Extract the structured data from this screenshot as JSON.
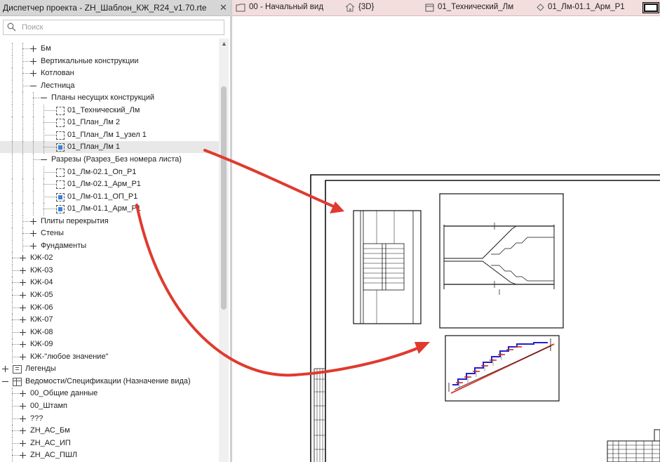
{
  "panel": {
    "title": "Диспетчер проекта - ZH_Шаблон_КЖ_R24_v1.70.rte",
    "close_label": "✕",
    "search_placeholder": "Поиск"
  },
  "tree": [
    {
      "label": "Бм",
      "depth": 2,
      "expander": "plus",
      "icon": "none"
    },
    {
      "label": "Вертикальные конструкции",
      "depth": 2,
      "expander": "plus",
      "icon": "none"
    },
    {
      "label": "Котлован",
      "depth": 2,
      "expander": "plus",
      "icon": "none"
    },
    {
      "label": "Лестница",
      "depth": 2,
      "expander": "minus",
      "icon": "none"
    },
    {
      "label": "Планы несущих конструкций",
      "depth": 3,
      "expander": "minus",
      "icon": "none"
    },
    {
      "label": "01_Технический_Лм",
      "depth": 4,
      "expander": "none",
      "icon": "view"
    },
    {
      "label": "01_План_Лм 2",
      "depth": 4,
      "expander": "none",
      "icon": "view"
    },
    {
      "label": "01_План_Лм 1_узел 1",
      "depth": 4,
      "expander": "none",
      "icon": "view"
    },
    {
      "label": "01_План_Лм 1",
      "depth": 4,
      "expander": "none",
      "icon": "view-blue",
      "selected": true
    },
    {
      "label": "Разрезы (Разрез_Без номера листа)",
      "depth": 3,
      "expander": "minus",
      "icon": "none"
    },
    {
      "label": "01_Лм-02.1_Оп_Р1",
      "depth": 4,
      "expander": "none",
      "icon": "view"
    },
    {
      "label": "01_Лм-02.1_Арм_Р1",
      "depth": 4,
      "expander": "none",
      "icon": "view"
    },
    {
      "label": "01_Лм-01.1_ОП_Р1",
      "depth": 4,
      "expander": "none",
      "icon": "view-blue"
    },
    {
      "label": "01_Лм-01.1_Арм_Р1",
      "depth": 4,
      "expander": "none",
      "icon": "view-blue"
    },
    {
      "label": "Плиты перекрытия",
      "depth": 2,
      "expander": "plus",
      "icon": "none"
    },
    {
      "label": "Стены",
      "depth": 2,
      "expander": "plus",
      "icon": "none"
    },
    {
      "label": "Фундаменты",
      "depth": 2,
      "expander": "plus",
      "icon": "none"
    },
    {
      "label": "КЖ-02",
      "depth": 1,
      "expander": "plus",
      "icon": "none"
    },
    {
      "label": "КЖ-03",
      "depth": 1,
      "expander": "plus",
      "icon": "none"
    },
    {
      "label": "КЖ-04",
      "depth": 1,
      "expander": "plus",
      "icon": "none"
    },
    {
      "label": "КЖ-05",
      "depth": 1,
      "expander": "plus",
      "icon": "none"
    },
    {
      "label": "КЖ-06",
      "depth": 1,
      "expander": "plus",
      "icon": "none"
    },
    {
      "label": "КЖ-07",
      "depth": 1,
      "expander": "plus",
      "icon": "none"
    },
    {
      "label": "КЖ-08",
      "depth": 1,
      "expander": "plus",
      "icon": "none"
    },
    {
      "label": "КЖ-09",
      "depth": 1,
      "expander": "plus",
      "icon": "none"
    },
    {
      "label": "КЖ-\"любое значение\"",
      "depth": 1,
      "expander": "plus",
      "icon": "none"
    },
    {
      "label": "Легенды",
      "depth": 0,
      "expander": "plus",
      "icon": "legend"
    },
    {
      "label": "Ведомости/Спецификации (Назначение вида)",
      "depth": 0,
      "expander": "minus",
      "icon": "schedule"
    },
    {
      "label": "00_Общие данные",
      "depth": 1,
      "expander": "plus",
      "icon": "none"
    },
    {
      "label": "00_Штамп",
      "depth": 1,
      "expander": "plus",
      "icon": "none"
    },
    {
      "label": "???",
      "depth": 1,
      "expander": "plus",
      "icon": "none"
    },
    {
      "label": "ZH_АС_Бм",
      "depth": 1,
      "expander": "plus",
      "icon": "none"
    },
    {
      "label": "ZH_АС_ИП",
      "depth": 1,
      "expander": "plus",
      "icon": "none"
    },
    {
      "label": "ZH_АС_ПШЛ",
      "depth": 1,
      "expander": "plus",
      "icon": "none"
    }
  ],
  "tabs": [
    {
      "label": "00 - Начальный вид",
      "icon": "sheet-icon"
    },
    {
      "label": "{3D}",
      "icon": "house-icon"
    },
    {
      "label": "01_Технический_Лм",
      "icon": "plan-icon"
    },
    {
      "label": "01_Лм-01.1_Арм_Р1",
      "icon": "section-icon"
    }
  ],
  "colors": {
    "accent_blue": "#3b83d9",
    "arrow_red": "#e03a2f",
    "tab_bar_bg": "#f3dede"
  }
}
